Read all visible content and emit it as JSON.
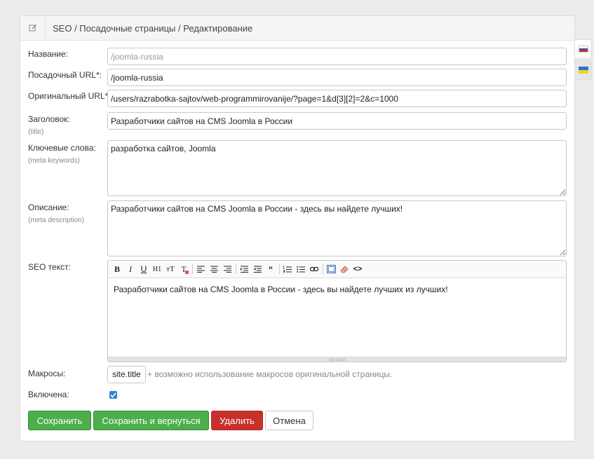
{
  "header": {
    "title": "SEO / Посадочные страницы / Редактирование",
    "icon": "edit-icon"
  },
  "fields": {
    "name": {
      "label": "Название:",
      "placeholder": "/joomla-russia",
      "value": ""
    },
    "landing_url": {
      "label": "Посадочный URL",
      "required_mark": "*",
      "value": "/joomla-russia"
    },
    "original_url": {
      "label": "Оригинальный URL",
      "required_mark": "*",
      "value": "/users/razrabotka-sajtov/web-programmirovanije/?page=1&d[3][2]=2&c=1000"
    },
    "title": {
      "label": "Заголовок:",
      "sublabel": "(title)",
      "value": "Разработчики сайтов на CMS Joomla в России"
    },
    "keywords": {
      "label": "Ключевые слова:",
      "sublabel": "(meta keywords)",
      "value": "разработка сайтов, Joomla"
    },
    "description": {
      "label": "Описание:",
      "sublabel": "(meta description)",
      "value": "Разработчики сайтов на CMS Joomla в России - здесь вы найдете лучших!"
    },
    "seo_text": {
      "label": "SEO текст:",
      "value": "Разработчики сайтов на CMS Joomla в России - здесь вы найдете лучших из лучших!"
    },
    "macros": {
      "label": "Макросы:",
      "tag": "site.title",
      "hint": "+ возможно использование макросов оригинальной страницы."
    },
    "enabled": {
      "label": "Включена:",
      "checked": true
    }
  },
  "toolbar": {
    "bold": "B",
    "italic": "I",
    "underline": "U",
    "heading": "H1",
    "font_size": "тT",
    "color": "T",
    "quote": "“",
    "code": "<>",
    "icons": [
      "bold-icon",
      "italic-icon",
      "underline-icon",
      "heading-icon",
      "font-size-icon",
      "text-color-icon",
      "align-left-icon",
      "align-center-icon",
      "align-right-icon",
      "indent-icon",
      "outdent-icon",
      "quote-icon",
      "ordered-list-icon",
      "unordered-list-icon",
      "link-icon",
      "fullscreen-icon",
      "eraser-icon",
      "code-icon"
    ]
  },
  "buttons": {
    "save": "Сохранить",
    "save_return": "Сохранить и вернуться",
    "delete": "Удалить",
    "cancel": "Отмена"
  },
  "languages": [
    {
      "name": "russian-flag-icon",
      "colors": [
        "#ffffff",
        "#2b4fc7",
        "#d52b1e"
      ]
    },
    {
      "name": "ukrainian-flag-icon",
      "colors": [
        "#2e6fd6",
        "#f0d028"
      ]
    }
  ],
  "colors": {
    "green": "#4cae4c",
    "red": "#c9302c",
    "checkbox": "#2f80d6"
  }
}
